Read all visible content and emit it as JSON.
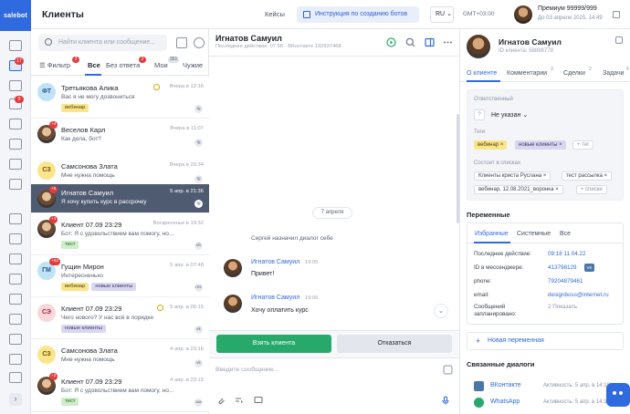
{
  "brand": {
    "logo_text": "salebot"
  },
  "rail": {
    "badge_count": "17",
    "badge_count2": "9",
    "expand_glyph": "›"
  },
  "header": {
    "title": "Клиенты",
    "bots_link": "Кейсы",
    "instruction_button": "Инструкция по созданию ботов",
    "language": "RU",
    "language_caret": "⌄",
    "timezone": "GMT+03:00",
    "plan_title": "Премиум 99999/999",
    "plan_until": "До 03 апреля 2025, 14:49"
  },
  "clients_panel": {
    "search_placeholder": "Найти клиента или сообщение...",
    "tabs": {
      "filter": "Фильтр",
      "filter_badge": "2",
      "all": "Все",
      "no_answer": "Без ответа",
      "no_answer_badge": "2",
      "mine": "Мои",
      "mine_badge": "351",
      "others": "Чужие"
    },
    "items": [
      {
        "initials": "ФТ",
        "name": "Третьякова Алика",
        "message": "Вас я не могу дозвониться",
        "time": "Вчера в 12:16",
        "tags": [
          "вебинар"
        ],
        "channel": "tg"
      },
      {
        "badge": "+4",
        "name": "Веселов Карл",
        "message": "Как дела, бот?",
        "time": "Вчера в 11:07",
        "channel": "tg"
      },
      {
        "initials": "СЗ",
        "name": "Самсонова Злата",
        "message": "Мне нужна помощь",
        "time": "Вчера в 20:34",
        "channel": "tg"
      },
      {
        "badge": "+5",
        "name": "Игнатов Самуил",
        "message": "Я хочу купить курс в рассрочку",
        "time": "5 апр. в 21:36",
        "channel": "tg"
      },
      {
        "badge": "+1",
        "name": "Клиент 07.09 23:29",
        "message": "Бот: Я с удовольствием вам помогу, но...",
        "time": "Воскресенье в 19:32",
        "tags": [
          "тест"
        ],
        "channel": "vb"
      },
      {
        "initials": "ГМ",
        "badge": "+52",
        "name": "Гущин Мирон",
        "message": "Интересненько",
        "time": "5 апр. в 07:48",
        "tags": [
          "вебинар",
          "новые клиенты"
        ],
        "channel": "ms"
      },
      {
        "initials": "СЭ",
        "name": "Клиент 07.09 23:29",
        "message": "Чего нового? У нас всё в порядке",
        "time": "5 апр. в 06:15",
        "tags": [
          "новые клиенты"
        ],
        "channel": "vk"
      },
      {
        "initials": "СЗ",
        "name": "Самсонова Злата",
        "message": "Мне нужна помощь",
        "time": "4 апр. в 23:16",
        "channel": "vk"
      },
      {
        "badge": "+2",
        "name": "Клиент 07.09 23:29",
        "message": "Бот: Я с удовольствием вам помогу, но...",
        "time": "4 апр. в 23:15",
        "tags": [
          "тест"
        ],
        "channel": "wa"
      }
    ]
  },
  "chat": {
    "name": "Игнатов Самуил",
    "subtitle": "Последнее действие: 07:56 · ВКонтакте 192937468",
    "date_label": "7 апреля",
    "system_message": "Сергей назначил диалог себе",
    "messages": [
      {
        "author": "Игнатов Самуил",
        "time": "19:05",
        "text": "Привет!"
      },
      {
        "author": "Игнатов Самуил",
        "time": "19:06",
        "text": "Хочу оплатить курс"
      }
    ],
    "take_button": "Взять клиента",
    "refuse_button": "Отказаться",
    "input_placeholder": "Введите сообщение...",
    "scroll_down_glyph": "⌄"
  },
  "profile": {
    "name": "Игнатов Самуил",
    "client_id": "ID клиента: 58898778",
    "tabs": {
      "about": "О клиенте",
      "comments": "Комментарии",
      "comments_badge": "3",
      "deals": "Сделки",
      "deals_badge": "2",
      "tasks": "Задачи",
      "tasks_badge": "4"
    },
    "responsible_label": "Ответственный",
    "responsible_glyph": "?",
    "responsible_value": "Не указан ⌄",
    "tags_label": "Теги",
    "tags": [
      "вебинар ×",
      "новые клиенты ×"
    ],
    "add_tag": "+ тег",
    "lists_label": "Состоит в списках",
    "lists": [
      "Клиенты криста Руслана ×",
      "тест рассылка ×",
      "вебинар, 12.08.2021_воронка ×"
    ],
    "add_list": "+ списки",
    "variables_title": "Переменные",
    "var_tabs": {
      "favorites": "Избранные",
      "system": "Системные",
      "all": "Все"
    },
    "variables": [
      {
        "key": "Последнее действие:",
        "value": "09:18 11.04.22"
      },
      {
        "key": "ID в мессенджере:",
        "value": "413798129"
      },
      {
        "key": "phone:",
        "value": "79204879461"
      },
      {
        "key": "email:",
        "value": "designboss@internet.ru"
      },
      {
        "key": "Сообщений запланировано:",
        "value": "2  Показать"
      }
    ],
    "messenger_tag": "VK",
    "new_variable": "Новая переменная",
    "new_variable_glyph": "+",
    "linked_title": "Связанные диалоги",
    "linked": [
      {
        "channel": "ВКонтакте",
        "activity": "Активность: 5 апр. в 14:18"
      },
      {
        "channel": "WhatsApp",
        "activity": "Активность: 5 апр. в 14:19"
      }
    ]
  },
  "colors": {
    "accent": "#2f6bde",
    "success": "#27a96c",
    "badge": "#e53b3b",
    "selected_row": "#4f5b71"
  }
}
